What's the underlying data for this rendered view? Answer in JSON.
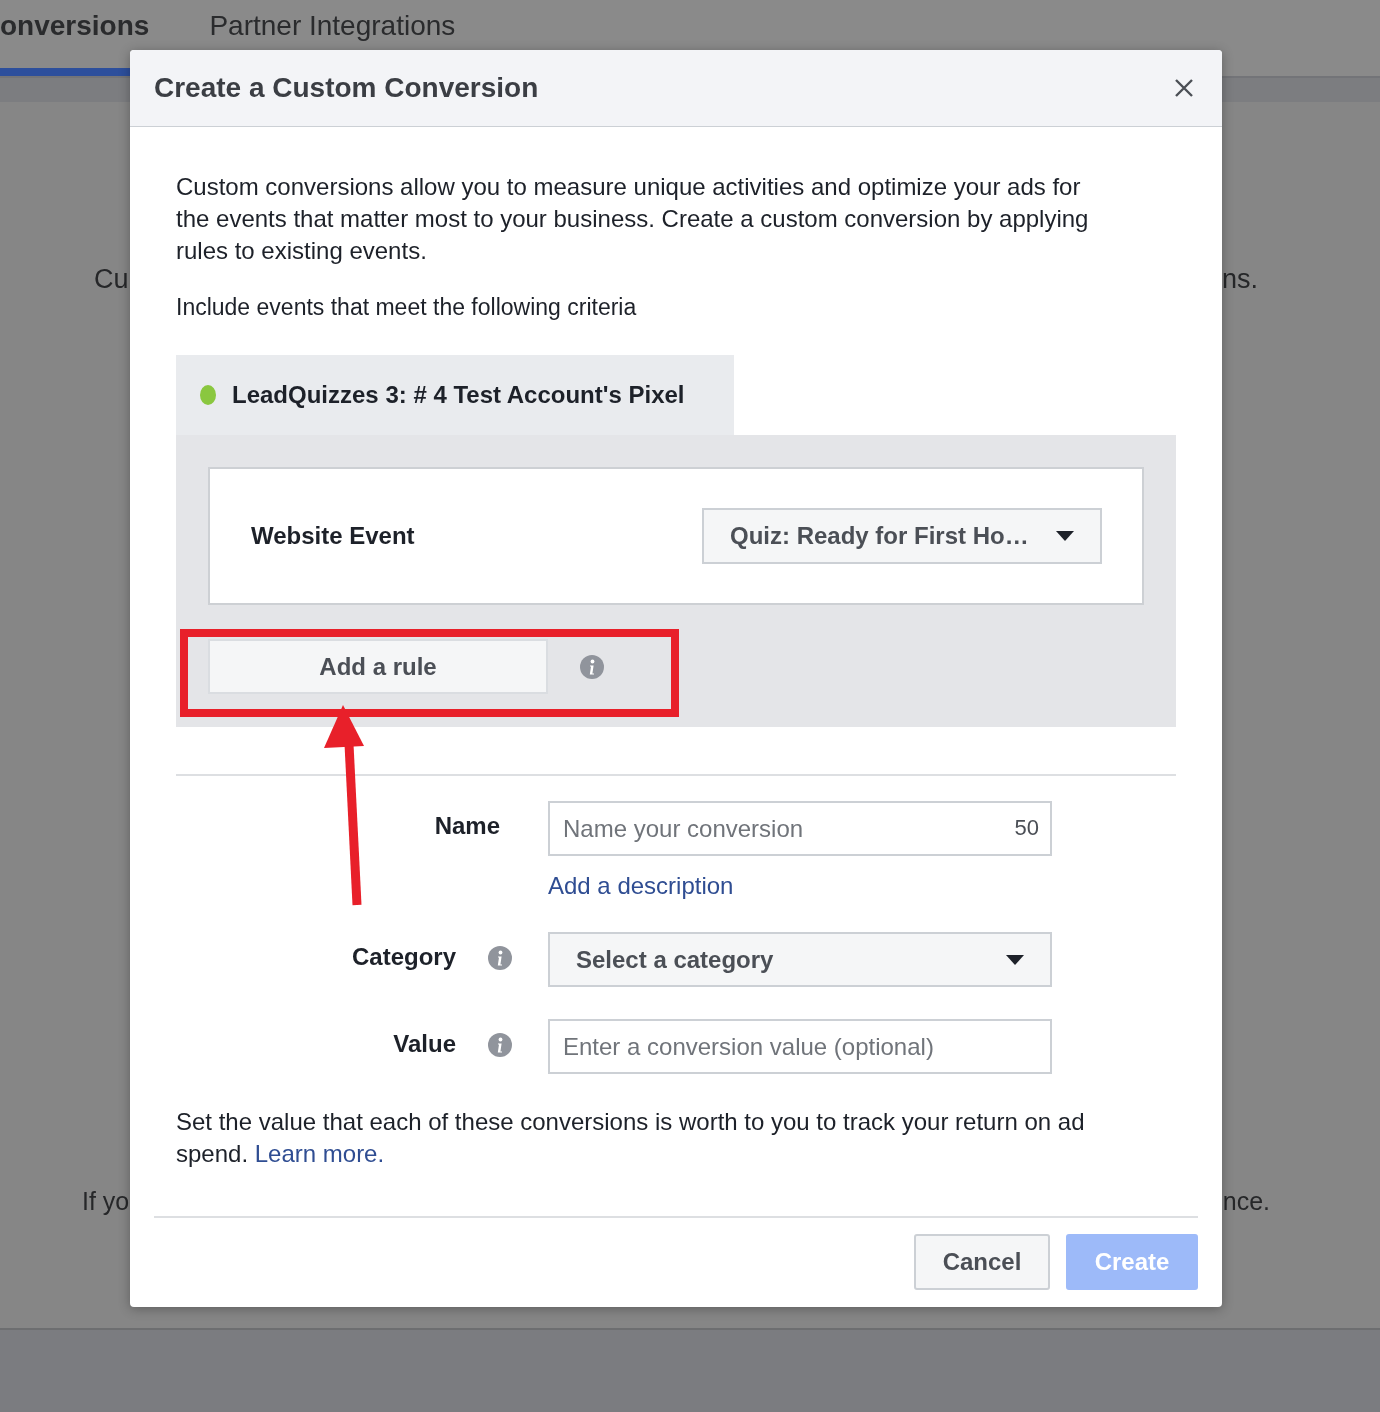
{
  "background": {
    "tabs": [
      {
        "label": "onversions",
        "selected": true
      },
      {
        "label": "Partner Integrations",
        "selected": false
      }
    ],
    "texts": [
      "Cu",
      "ns.",
      "If yo",
      "nce."
    ]
  },
  "dialog": {
    "title": "Create a Custom Conversion",
    "intro": "Custom conversions allow you to measure unique activities and optimize your ads for the events that matter most to your business. Create a custom conversion by applying rules to existing events.",
    "criteria_label": "Include events that meet the following criteria",
    "pixel": {
      "name": "LeadQuizzes 3: # 4 Test Account's Pixel",
      "active": true
    },
    "event": {
      "label": "Website Event",
      "value": "Quiz: Ready for First Ho…"
    },
    "add_rule": "Add a rule",
    "fields": [
      {
        "kind": "text",
        "label": "Name",
        "info": false,
        "placeholder": "Name your conversion",
        "counter": "50",
        "link": "Add a description"
      },
      {
        "kind": "select",
        "label": "Category",
        "info": true,
        "value": "Select a category"
      },
      {
        "kind": "text",
        "label": "Value",
        "info": true,
        "placeholder": "Enter a conversion value (optional)"
      }
    ],
    "note": "Set the value that each of these conversions is worth to you to track your return on ad spend.",
    "note_link": "Learn more.",
    "buttons": [
      {
        "label": "Cancel",
        "kind": "secondary",
        "disabled": false
      },
      {
        "label": "Create",
        "kind": "primary",
        "disabled": true
      }
    ],
    "annotation": {
      "highlight": true,
      "arrow": true
    }
  }
}
